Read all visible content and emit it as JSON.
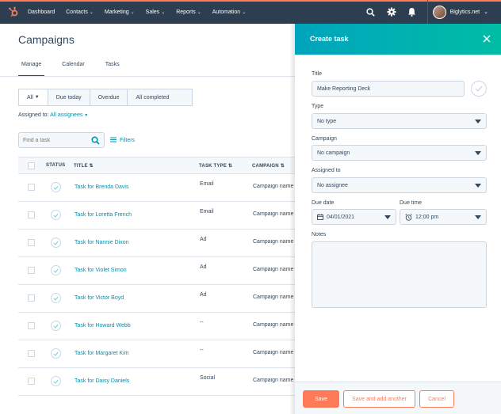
{
  "nav": {
    "items": [
      {
        "label": "Dashboard",
        "dropdown": false
      },
      {
        "label": "Contacts",
        "dropdown": true
      },
      {
        "label": "Marketing",
        "dropdown": true
      },
      {
        "label": "Sales",
        "dropdown": true
      },
      {
        "label": "Reports",
        "dropdown": true
      },
      {
        "label": "Automation",
        "dropdown": true
      }
    ],
    "account_name": "Biglytics.net",
    "brand_color": "#ff7a59",
    "bg_color": "#2d3e50"
  },
  "page": {
    "title": "Campaigns",
    "tabs": [
      "Manage",
      "Calendar",
      "Tasks"
    ],
    "active_tab": "Manage"
  },
  "filters": {
    "segments": [
      "All",
      "Due today",
      "Overdue",
      "All completed"
    ],
    "active": "All",
    "assigned_label": "Assigned to:",
    "assigned_value": "All assignees",
    "search_placeholder": "Find a task",
    "filters_label": "Filters"
  },
  "table": {
    "headers": {
      "status": "STATUS",
      "title": "TITLE",
      "task_type": "TASK TYPE",
      "campaign": "CAMPAIGN"
    },
    "rows": [
      {
        "title": "Task for Brenda Davis",
        "task_type": "Email",
        "campaign": "Campaign name"
      },
      {
        "title": "Task for Loretta French",
        "task_type": "Email",
        "campaign": "Campaign name"
      },
      {
        "title": "Task for Nannie Dixon",
        "task_type": "Ad",
        "campaign": "Campaign name"
      },
      {
        "title": "Task for Violet Simon",
        "task_type": "Ad",
        "campaign": "Campaign name"
      },
      {
        "title": "Task for Victor Boyd",
        "task_type": "Ad",
        "campaign": "Campaign name"
      },
      {
        "title": "Task for Howard Webb",
        "task_type": "--",
        "campaign": "Campaign name"
      },
      {
        "title": "Task for Margaret Kim",
        "task_type": "--",
        "campaign": "Campaign name"
      },
      {
        "title": "Task for Daisy Daniels",
        "task_type": "Social",
        "campaign": "Campaign name"
      }
    ]
  },
  "panel": {
    "title": "Create task",
    "title_label": "Title",
    "title_value": "Make Reporting Deck",
    "type_label": "Type",
    "type_value": "No type",
    "campaign_label": "Campaign",
    "campaign_value": "No campaign",
    "assigned_label": "Assigned to",
    "assigned_value": "No assignee",
    "due_date_label": "Due date",
    "due_date_value": "04/01/2021",
    "due_time_label": "Due time",
    "due_time_value": "12:00 pm",
    "notes_label": "Notes",
    "notes_value": "",
    "save_label": "Save",
    "save_add_label": "Save and add another",
    "cancel_label": "Cancel",
    "accent_start": "#00a4bd",
    "accent_end": "#00bda5"
  }
}
